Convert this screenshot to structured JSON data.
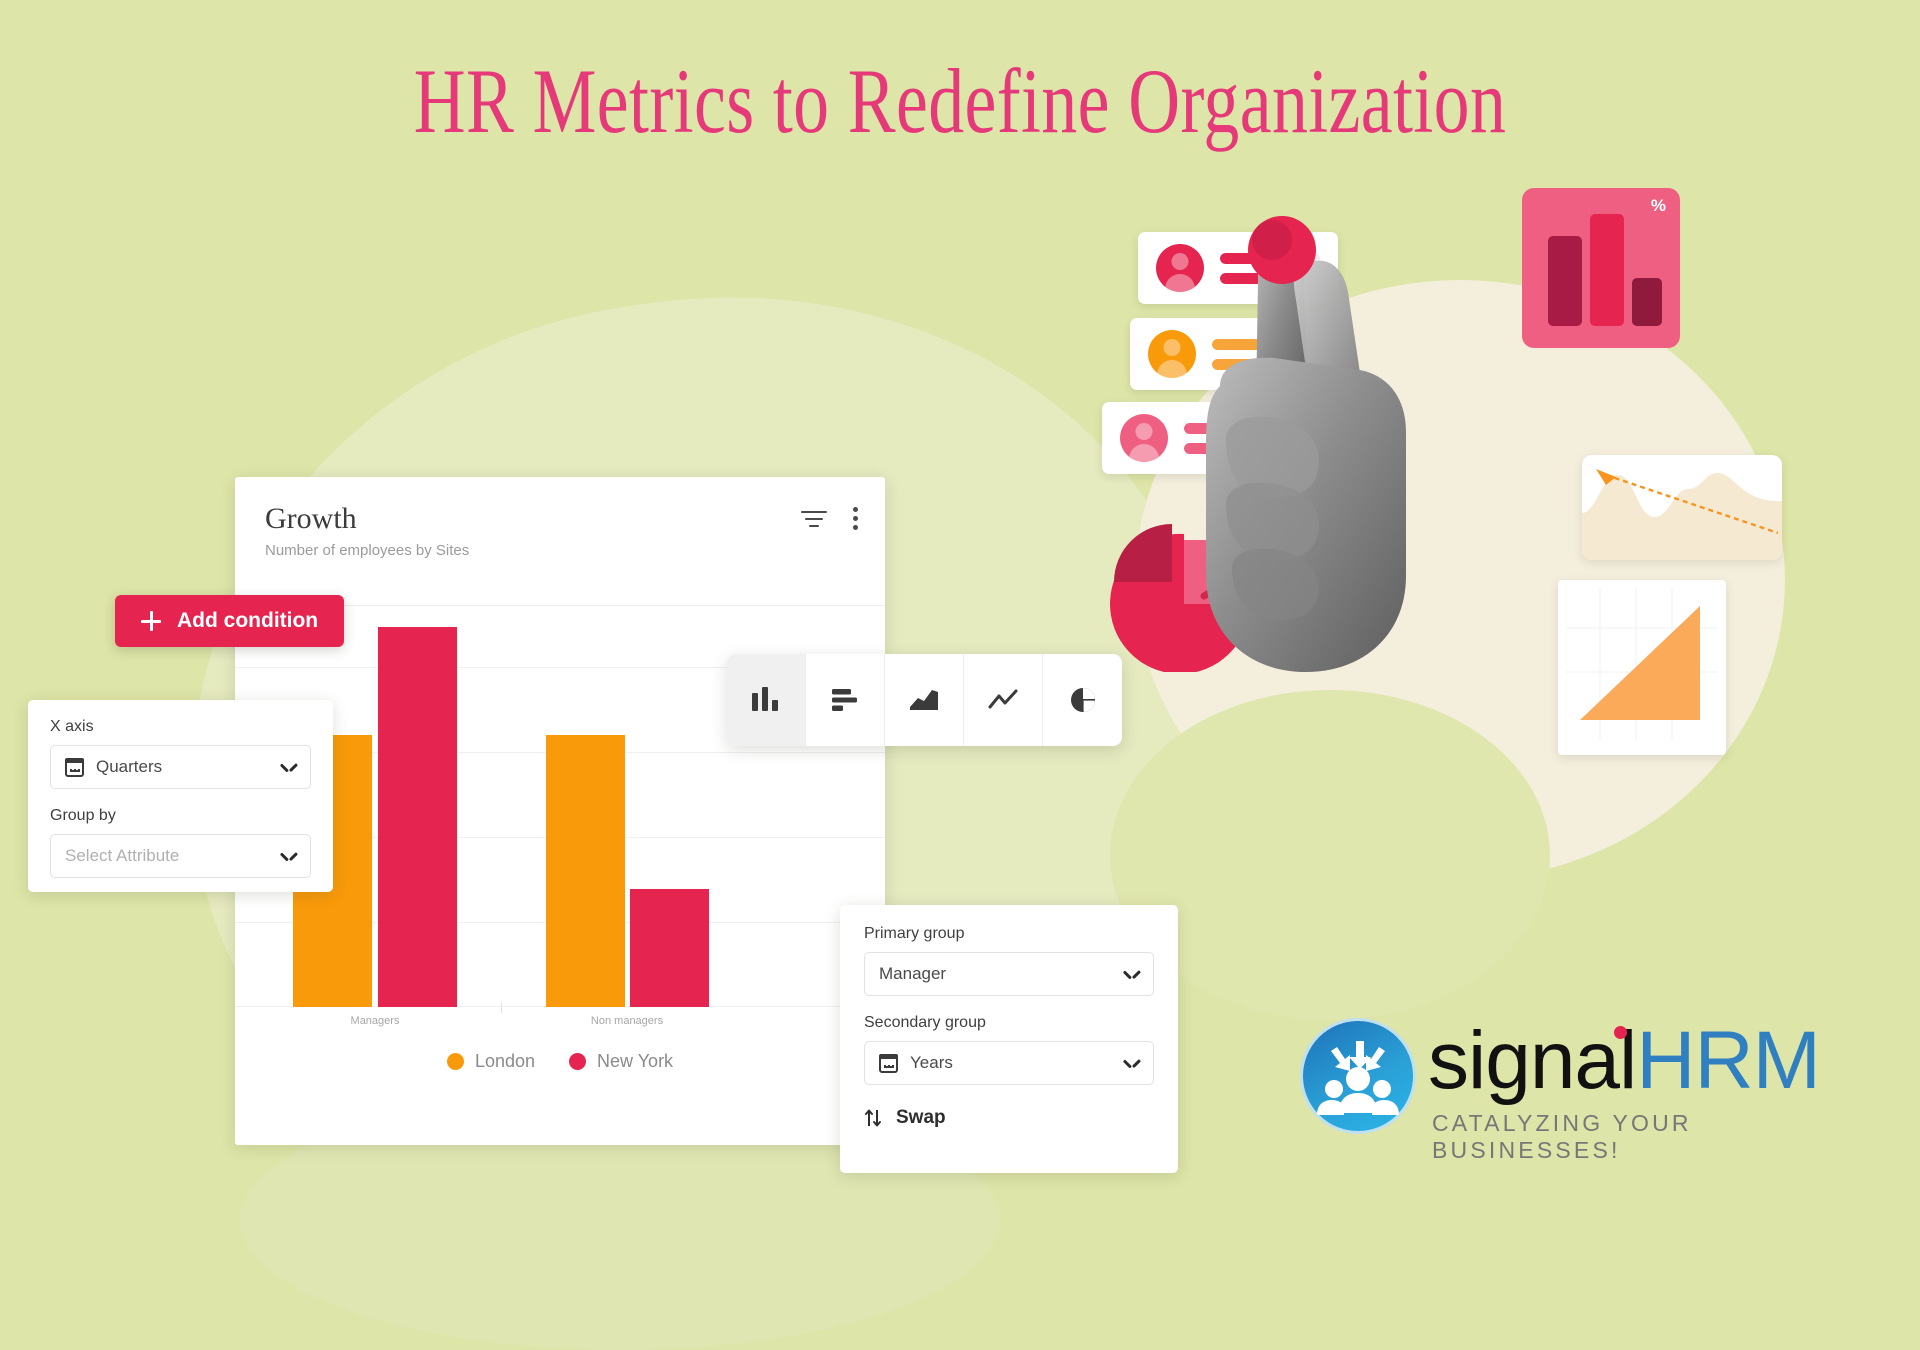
{
  "headline": "HR Metrics to Redefine Organization",
  "theme": {
    "background": "#dde5a8",
    "headline_color": "#e6397a",
    "accent_crimson": "#e5254f",
    "accent_orange": "#f99a0b",
    "accent_pink": "#ef5f82",
    "logo_blue": "#2f7fc1"
  },
  "dashboard": {
    "title": "Growth",
    "subtitle": "Number of employees by Sites",
    "filter_icon": "filter-icon",
    "menu_icon": "more-vertical-icon",
    "add_condition_label": "Add condition",
    "add_condition_icon": "plus-icon"
  },
  "axis_panel": {
    "x_axis_label": "X axis",
    "x_axis_value": "Quarters",
    "x_axis_icon": "calendar-icon",
    "group_by_label": "Group by",
    "group_by_placeholder": "Select Attribute",
    "chevron_icon": "chevron-down-icon"
  },
  "group_panel": {
    "primary_label": "Primary group",
    "primary_value": "Manager",
    "secondary_label": "Secondary group",
    "secondary_value": "Years",
    "secondary_icon": "calendar-icon",
    "swap_label": "Swap",
    "swap_icon": "swap-vertical-icon",
    "chevron_icon": "chevron-down-icon"
  },
  "chart_types": [
    {
      "name": "column-chart-icon",
      "label": "Column",
      "selected": true
    },
    {
      "name": "bar-chart-icon",
      "label": "Bar",
      "selected": false
    },
    {
      "name": "area-chart-icon",
      "label": "Area",
      "selected": false
    },
    {
      "name": "line-chart-icon",
      "label": "Line",
      "selected": false
    },
    {
      "name": "pie-chart-icon",
      "label": "Pie",
      "selected": false
    }
  ],
  "chart_data": {
    "type": "bar",
    "title": "Growth",
    "subtitle": "Number of employees by Sites",
    "xlabel": "",
    "ylabel": "",
    "categories": [
      "Managers",
      "Non managers"
    ],
    "series": [
      {
        "name": "London",
        "color": "#f99a0b",
        "values": [
          72,
          72
        ]
      },
      {
        "name": "New York",
        "color": "#e5254f",
        "values": [
          100,
          31
        ]
      }
    ],
    "ylim": [
      0,
      110
    ],
    "grid": true,
    "legend_position": "bottom"
  },
  "collage": {
    "user_cards": [
      {
        "name": "user-card",
        "avatar_color": "#e5254f",
        "bar_color": "#e5254f"
      },
      {
        "name": "user-card",
        "avatar_color": "#f99a0b",
        "bar_color": "#f7a43a"
      },
      {
        "name": "user-card",
        "avatar_color": "#ef5f82",
        "bar_color": "#ef5f82"
      }
    ],
    "bar_card": {
      "name": "bar-chart-card",
      "percent_symbol": "%"
    },
    "wave_card": {
      "name": "wave-chart-card",
      "arrow_color": "#f7941e"
    },
    "triangle_card": {
      "name": "growth-triangle-card",
      "color": "#fbaa5a"
    },
    "pie_graphic": {
      "name": "pie-chart-graphic",
      "color": "#e5254f"
    },
    "line_card": {
      "name": "line-chart-card",
      "color": "#ef5f82"
    },
    "hand": {
      "name": "pointing-hand-image"
    }
  },
  "logo": {
    "word_primary": "signal",
    "word_secondary": "HRM",
    "tagline": "CATALYZING YOUR BUSINESSES!",
    "mark": "people-arrows-icon"
  }
}
